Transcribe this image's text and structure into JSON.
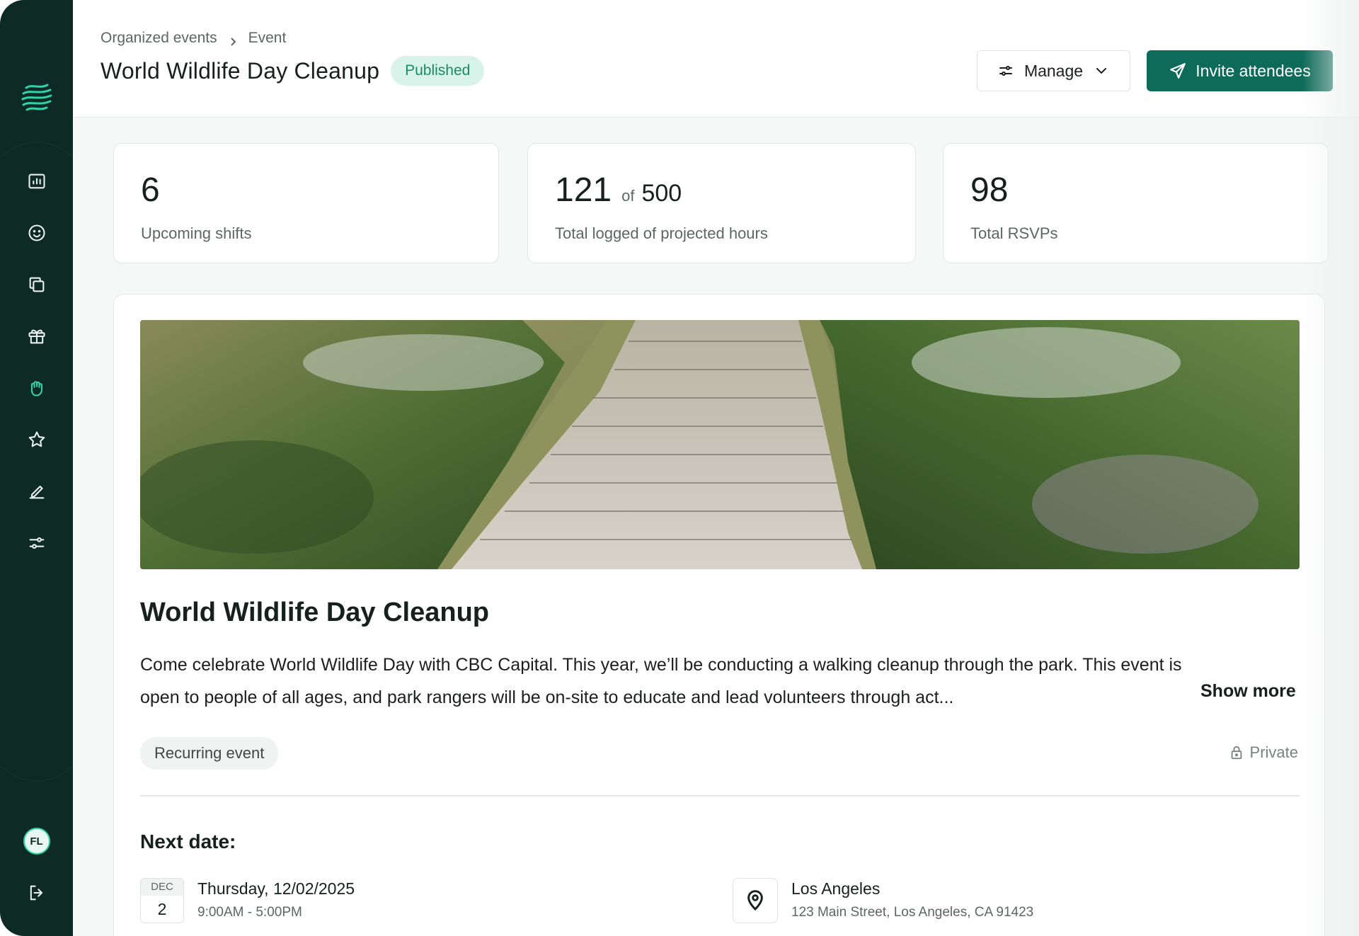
{
  "sidebar": {
    "logo": "wave-logo",
    "items": [
      {
        "icon": "dashboard-chart-icon",
        "active": false
      },
      {
        "icon": "smiley-icon",
        "active": false
      },
      {
        "icon": "copy-icon",
        "active": false
      },
      {
        "icon": "gift-icon",
        "active": false
      },
      {
        "icon": "raised-hand-icon",
        "active": true
      },
      {
        "icon": "star-icon",
        "active": false
      },
      {
        "icon": "pen-icon",
        "active": false
      },
      {
        "icon": "sliders-icon",
        "active": false
      }
    ],
    "avatar_initials": "FL",
    "logout_icon": "logout-icon"
  },
  "header": {
    "breadcrumb": [
      "Organized events",
      "Event"
    ],
    "title": "World Wildlife Day Cleanup",
    "status": "Published",
    "manage_label": "Manage",
    "invite_label": "Invite attendees"
  },
  "stats": [
    {
      "value": "6",
      "label": "Upcoming shifts"
    },
    {
      "value": "121",
      "of": "of",
      "total": "500",
      "label": "Total logged of projected hours"
    },
    {
      "value": "98",
      "label": "Total RSVPs"
    }
  ],
  "event": {
    "title": "World Wildlife Day Cleanup",
    "description": "Come celebrate World Wildlife Day with CBC Capital. This year, we’ll be conducting a walking cleanup through the park. This event is open to people of all ages, and park rangers will be on-site to educate and lead volunteers through act...",
    "show_more": "Show more",
    "tag": "Recurring event",
    "visibility": "Private",
    "next_date_label": "Next date:",
    "date": {
      "month": "DEC",
      "day": "2",
      "full": "Thursday, 12/02/2025",
      "time": "9:00AM - 5:00PM"
    },
    "location": {
      "name": "Los Angeles",
      "address": "123 Main Street, Los Angeles, CA 91423"
    }
  },
  "colors": {
    "sidebar": "#0e2a25",
    "accent": "#0f6b59",
    "active_icon": "#2fd3a6",
    "badge_bg": "#d8f4ea"
  }
}
